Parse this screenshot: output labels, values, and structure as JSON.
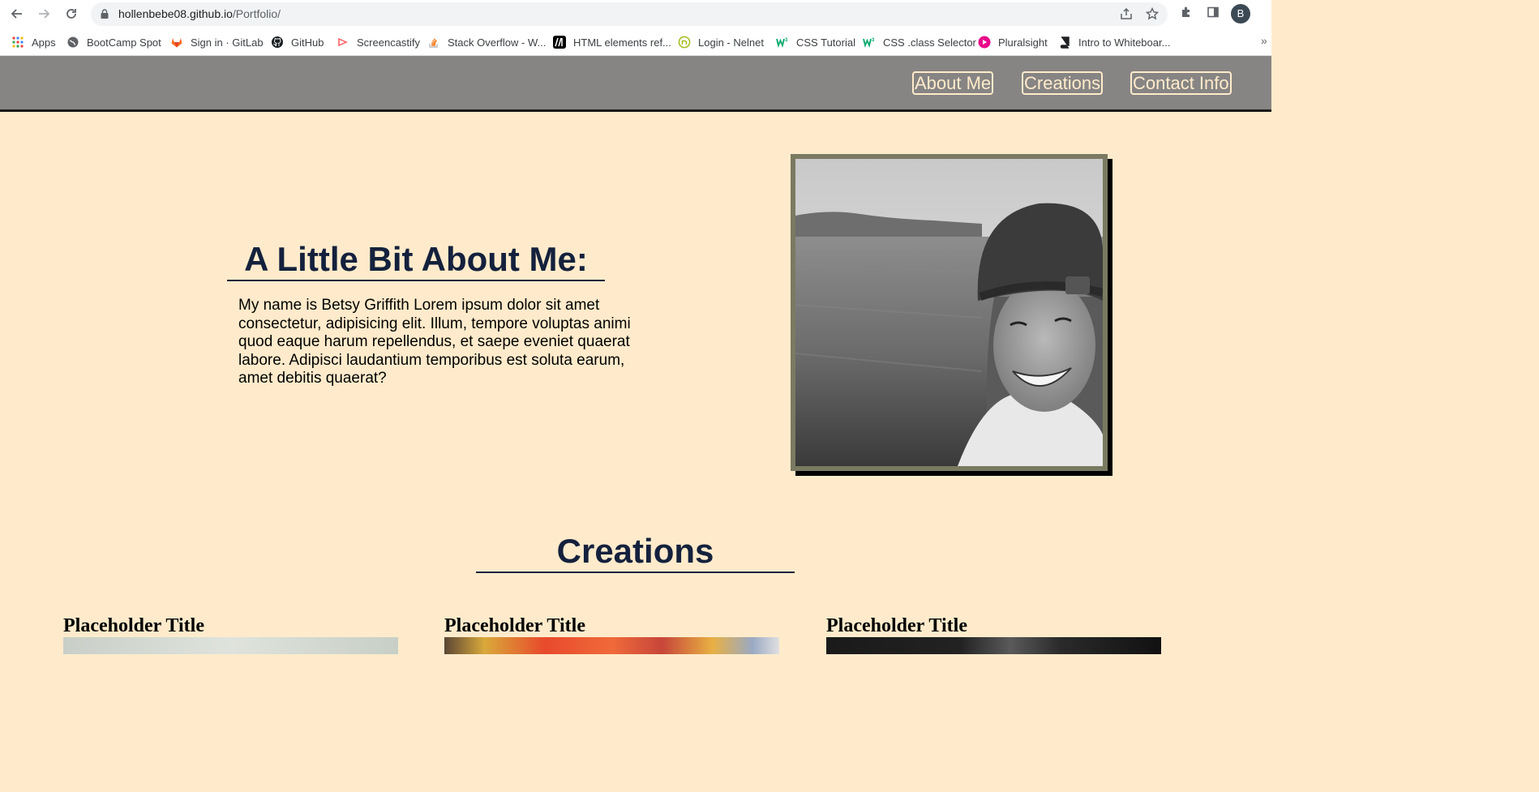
{
  "browser": {
    "url_host": "hollenbebe08.github.io",
    "url_path": "/Portfolio/",
    "avatar_letter": "B",
    "bookmarks": [
      {
        "label": "Apps",
        "icon": "apps-grid-icon"
      },
      {
        "label": "BootCamp Spot",
        "icon": "globe-icon"
      },
      {
        "label": "Sign in · GitLab",
        "icon": "gitlab-icon"
      },
      {
        "label": "GitHub",
        "icon": "github-icon"
      },
      {
        "label": "Screencastify",
        "icon": "screencastify-icon"
      },
      {
        "label": "Stack Overflow - W...",
        "icon": "stackoverflow-icon"
      },
      {
        "label": "HTML elements ref...",
        "icon": "mdn-icon"
      },
      {
        "label": "Login - Nelnet",
        "icon": "nelnet-icon"
      },
      {
        "label": "CSS Tutorial",
        "icon": "w3schools-icon"
      },
      {
        "label": "CSS .class Selector",
        "icon": "w3schools-icon"
      },
      {
        "label": "Pluralsight",
        "icon": "pluralsight-icon"
      },
      {
        "label": "Intro to Whiteboar...",
        "icon": "book-icon"
      }
    ],
    "more_label": "»"
  },
  "header": {
    "nav": [
      {
        "label": "About Me"
      },
      {
        "label": "Creations"
      },
      {
        "label": "Contact Info"
      }
    ]
  },
  "about": {
    "title": "A Little Bit About Me:",
    "body": "My name is Betsy Griffith Lorem ipsum dolor sit amet consectetur, adipisicing elit. Illum, tempore voluptas animi quod eaque harum repellendus, et saepe eveniet quaerat labore. Adipisci laudantium temporibus est soluta earum, amet debitis quaerat?"
  },
  "creations": {
    "title": "Creations",
    "cards": [
      {
        "title": "Placeholder Title"
      },
      {
        "title": "Placeholder Title"
      },
      {
        "title": "Placeholder Title"
      }
    ]
  },
  "colors": {
    "page_bg": "#ffebcb",
    "header_bg": "#878584",
    "heading": "#14213d",
    "photo_border": "#7a7a62"
  }
}
